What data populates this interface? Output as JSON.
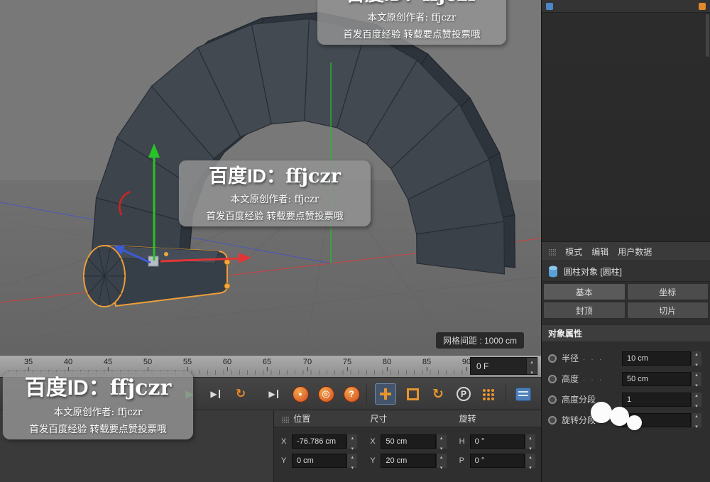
{
  "watermark": {
    "brand": "百度ID：",
    "user": "ffjczr",
    "author": "本文原创作者: ffjczr",
    "slogan": "首发百度经验 转载要点赞投票哦"
  },
  "viewport": {
    "grid_label": "网格间距 : 1000 cm"
  },
  "timeline": {
    "ticks": [
      "35",
      "40",
      "45",
      "50",
      "55",
      "60",
      "65",
      "70",
      "75",
      "80",
      "85",
      "90"
    ],
    "frame": "0 F"
  },
  "transport": {
    "p_label": "P",
    "help_label": "?"
  },
  "coord": {
    "position_title": "位置",
    "size_title": "尺寸",
    "rotation_title": "旋转",
    "pos_x_label": "X",
    "pos_x": "-76.786 cm",
    "pos_y_label": "Y",
    "pos_y": "0 cm",
    "size_x_label": "X",
    "size_x": "50 cm",
    "size_y_label": "Y",
    "size_y": "20 cm",
    "rot_h_label": "H",
    "rot_h": "0 °",
    "rot_p_label": "P",
    "rot_p": "0 °"
  },
  "attributes": {
    "menu_mode": "模式",
    "menu_edit": "编辑",
    "menu_user": "用户数据",
    "object_title": "圆柱对象 [圆柱]",
    "tab_basic": "基本",
    "tab_coord": "坐标",
    "tab_caps": "封顶",
    "tab_slice": "切片",
    "section_title": "对象属性",
    "rows": [
      {
        "label": "半径",
        "value": "10 cm"
      },
      {
        "label": "高度",
        "value": "50 cm"
      },
      {
        "label": "高度分段",
        "value": "1"
      },
      {
        "label": "旋转分段",
        "value": ""
      }
    ]
  }
}
